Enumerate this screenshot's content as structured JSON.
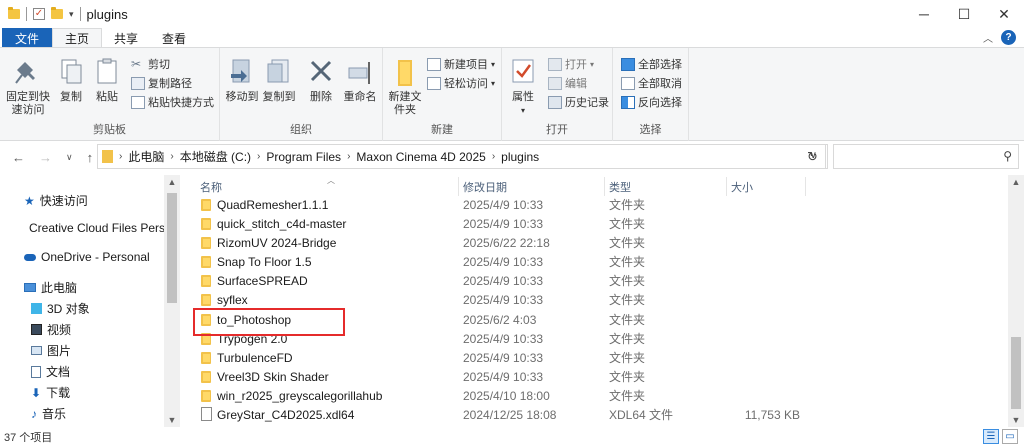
{
  "window": {
    "title": "plugins",
    "minimize": "─",
    "maximize": "☐",
    "close": "✕"
  },
  "tabs": {
    "file": "文件",
    "home": "主页",
    "share": "共享",
    "view": "查看"
  },
  "ribbon": {
    "clipboard": {
      "label": "剪贴板",
      "pin": "固定到快速访问",
      "copy": "复制",
      "paste": "粘贴",
      "cut": "剪切",
      "copy_path": "复制路径",
      "paste_shortcut": "粘贴快捷方式"
    },
    "organize": {
      "label": "组织",
      "move_to": "移动到",
      "copy_to": "复制到",
      "delete": "删除",
      "rename": "重命名"
    },
    "new": {
      "label": "新建",
      "new_folder": "新建文件夹",
      "new_item": "新建项目",
      "easy_access": "轻松访问"
    },
    "open": {
      "label": "打开",
      "properties": "属性",
      "open": "打开",
      "edit": "编辑",
      "history": "历史记录"
    },
    "select": {
      "label": "选择",
      "select_all": "全部选择",
      "select_none": "全部取消",
      "invert": "反向选择"
    }
  },
  "address": {
    "crumbs": [
      "此电脑",
      "本地磁盘 (C:)",
      "Program Files",
      "Maxon Cinema 4D 2025",
      "plugins"
    ]
  },
  "navpane": {
    "items": [
      {
        "label": "快速访问",
        "icon": "star-icon"
      },
      {
        "label": "Creative Cloud Files Pers",
        "icon": "creative-cloud-icon"
      },
      {
        "label": "OneDrive - Personal",
        "icon": "onedrive-cloud-icon"
      },
      {
        "label": "此电脑",
        "icon": "computer-icon"
      },
      {
        "label": "3D 对象",
        "icon": "3d-objects-icon"
      },
      {
        "label": "视频",
        "icon": "video-icon"
      },
      {
        "label": "图片",
        "icon": "pictures-icon"
      },
      {
        "label": "文档",
        "icon": "documents-icon"
      },
      {
        "label": "下载",
        "icon": "download-icon"
      },
      {
        "label": "音乐",
        "icon": "music-icon"
      }
    ]
  },
  "columns": {
    "name": "名称",
    "date": "修改日期",
    "type": "类型",
    "size": "大小"
  },
  "files": [
    {
      "name": "QuadRemesher1.1.1",
      "date": "2025/4/9 10:33",
      "type": "文件夹",
      "size": ""
    },
    {
      "name": "quick_stitch_c4d-master",
      "date": "2025/4/9 10:33",
      "type": "文件夹",
      "size": ""
    },
    {
      "name": "RizomUV 2024-Bridge",
      "date": "2025/6/22 22:18",
      "type": "文件夹",
      "size": ""
    },
    {
      "name": "Snap To Floor 1.5",
      "date": "2025/4/9 10:33",
      "type": "文件夹",
      "size": ""
    },
    {
      "name": "SurfaceSPREAD",
      "date": "2025/4/9 10:33",
      "type": "文件夹",
      "size": ""
    },
    {
      "name": "syflex",
      "date": "2025/4/9 10:33",
      "type": "文件夹",
      "size": ""
    },
    {
      "name": "to_Photoshop",
      "date": "2025/6/2 4:03",
      "type": "文件夹",
      "size": ""
    },
    {
      "name": "Trypogen 2.0",
      "date": "2025/4/9 10:33",
      "type": "文件夹",
      "size": ""
    },
    {
      "name": "TurbulenceFD",
      "date": "2025/4/9 10:33",
      "type": "文件夹",
      "size": ""
    },
    {
      "name": "Vreel3D Skin Shader",
      "date": "2025/4/9 10:33",
      "type": "文件夹",
      "size": ""
    },
    {
      "name": "win_r2025_greyscalegorillahub",
      "date": "2025/4/10 18:00",
      "type": "文件夹",
      "size": ""
    },
    {
      "name": "GreyStar_C4D2025.xdl64",
      "date": "2024/12/25 18:08",
      "type": "XDL64 文件",
      "size": "11,753 KB"
    }
  ],
  "status": {
    "count": "37 个项目"
  },
  "colors": {
    "file_tab": "#1a64b8",
    "highlight_box": "#e52b2b",
    "folder": "#f2c24a"
  }
}
